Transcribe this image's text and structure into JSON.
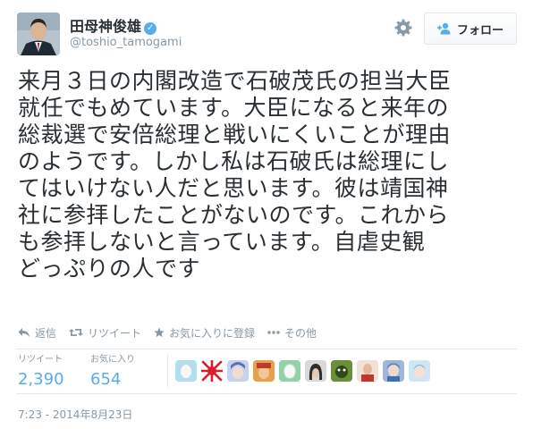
{
  "user": {
    "display_name": "田母神俊雄",
    "handle": "@toshio_tamogami",
    "verified_icon": "verified-badge-icon",
    "avatar_icon": "user-avatar"
  },
  "follow_button": {
    "label": "フォロー",
    "icon": "add-user-icon"
  },
  "tweet": {
    "text": "来月３日の内閣改造で石破茂氏の担当大臣\n就任でもめています。大臣になると来年の\n総裁選で安倍総理と戦いにくいことが理由\nのようです。しかし私は石破氏は総理にし\nてはいけない人だと思います。彼は靖国神\n社に参拝したことがないのです。これから\nも参拝しないと言っています。自虐史観\nどっぷりの人です"
  },
  "actions": {
    "reply": "返信",
    "retweet": "リツイート",
    "favorite": "お気に入りに登録",
    "more": "その他"
  },
  "stats": {
    "retweets_label": "リツイート",
    "retweets_value": "2,390",
    "favorites_label": "お気に入り",
    "favorites_value": "654"
  },
  "timestamp": "7:23 - 2014年8月23日",
  "colors": {
    "accent": "#55acee",
    "muted": "#8899a6",
    "text": "#292f33",
    "border": "#e1e8ed"
  }
}
